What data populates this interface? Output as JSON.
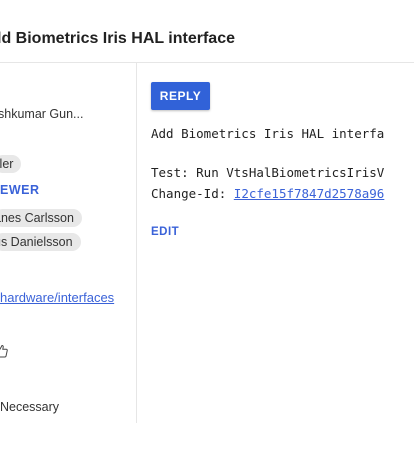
{
  "header": {
    "title": "ld Biometrics Iris HAL interface"
  },
  "sidebar": {
    "owner": "shkumar Gun...",
    "reviewer_chip_1": "iller",
    "add_reviewer": "EWER",
    "cc_chip_1": "anes Carlsson",
    "cc_chip_2": "us Danielsson",
    "repo_link": "hardware/interfaces",
    "thumb_icon": "thumbs-up-icon",
    "submit_requirement": "Necessary"
  },
  "main": {
    "reply_label": "REPLY",
    "message_line1": "Add Biometrics Iris HAL interfa",
    "message_test": "Test: Run VtsHalBiometricsIrisV",
    "change_id_prefix": "Change-Id: ",
    "change_id_value": "I2cfe15f7847d2578a96",
    "edit_label": "EDIT"
  },
  "colors": {
    "accent": "#3162d8",
    "link": "#3a62d8",
    "chip_bg": "#e8e8e8",
    "divider": "#e6e6e6"
  }
}
